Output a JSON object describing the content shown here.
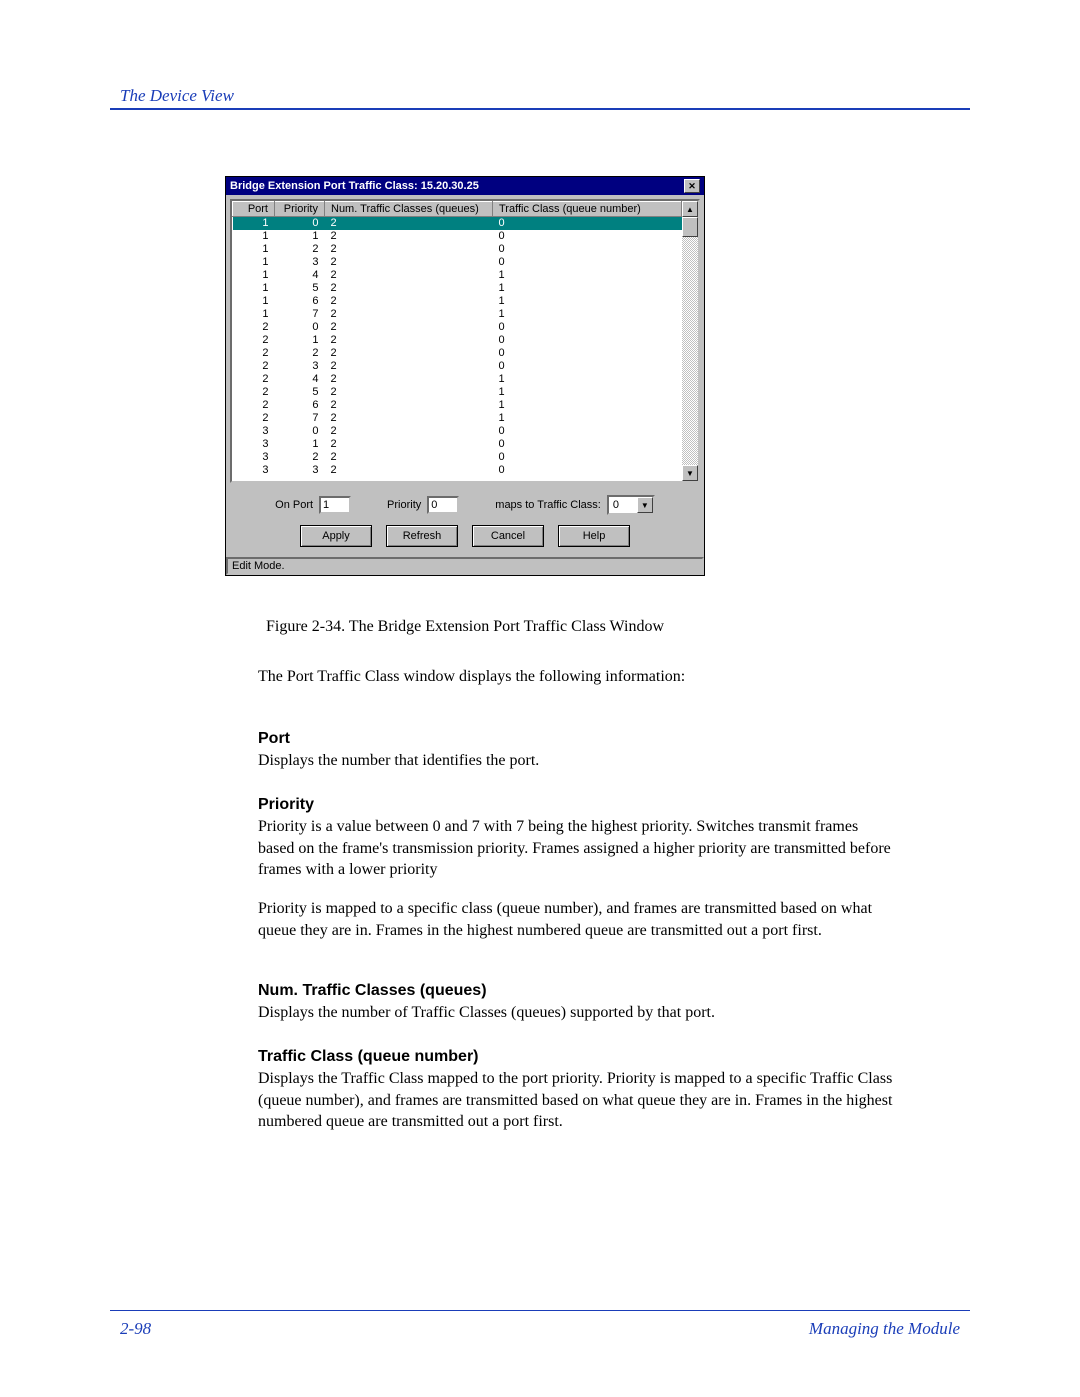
{
  "page": {
    "header": "The Device View",
    "footer_left": "2-98",
    "footer_right": "Managing the Module"
  },
  "figure": {
    "caption_prefix": "Figure 2-34.  ",
    "caption": "The Bridge Extension Port Traffic Class Window"
  },
  "window": {
    "title": "Bridge Extension Port Traffic Class: 15.20.30.25",
    "columns": [
      "Port",
      "Priority",
      "Num. Traffic Classes (queues)",
      "Traffic Class (queue number)"
    ],
    "selected_row": {
      "port": "1",
      "priority": "0",
      "num": "2",
      "tc": "0"
    },
    "rows": [
      {
        "port": "1",
        "priority": "1",
        "num": "2",
        "tc": "0"
      },
      {
        "port": "1",
        "priority": "2",
        "num": "2",
        "tc": "0"
      },
      {
        "port": "1",
        "priority": "3",
        "num": "2",
        "tc": "0"
      },
      {
        "port": "1",
        "priority": "4",
        "num": "2",
        "tc": "1"
      },
      {
        "port": "1",
        "priority": "5",
        "num": "2",
        "tc": "1"
      },
      {
        "port": "1",
        "priority": "6",
        "num": "2",
        "tc": "1"
      },
      {
        "port": "1",
        "priority": "7",
        "num": "2",
        "tc": "1"
      },
      {
        "port": "2",
        "priority": "0",
        "num": "2",
        "tc": "0"
      },
      {
        "port": "2",
        "priority": "1",
        "num": "2",
        "tc": "0"
      },
      {
        "port": "2",
        "priority": "2",
        "num": "2",
        "tc": "0"
      },
      {
        "port": "2",
        "priority": "3",
        "num": "2",
        "tc": "0"
      },
      {
        "port": "2",
        "priority": "4",
        "num": "2",
        "tc": "1"
      },
      {
        "port": "2",
        "priority": "5",
        "num": "2",
        "tc": "1"
      },
      {
        "port": "2",
        "priority": "6",
        "num": "2",
        "tc": "1"
      },
      {
        "port": "2",
        "priority": "7",
        "num": "2",
        "tc": "1"
      },
      {
        "port": "3",
        "priority": "0",
        "num": "2",
        "tc": "0"
      },
      {
        "port": "3",
        "priority": "1",
        "num": "2",
        "tc": "0"
      },
      {
        "port": "3",
        "priority": "2",
        "num": "2",
        "tc": "0"
      },
      {
        "port": "3",
        "priority": "3",
        "num": "2",
        "tc": "0"
      }
    ],
    "form": {
      "on_port_label": "On Port",
      "on_port_value": "1",
      "priority_label": "Priority",
      "priority_value": "0",
      "maps_label": "maps to Traffic Class:",
      "maps_value": "0"
    },
    "buttons": {
      "apply": "Apply",
      "refresh": "Refresh",
      "cancel": "Cancel",
      "help": "Help"
    },
    "statusbar": "Edit Mode."
  },
  "doc": {
    "intro": "The Port Traffic Class window displays the following information:",
    "port_h": "Port",
    "port_p": "Displays the number that identifies the port.",
    "priority_h": "Priority",
    "priority_p": "Priority is a value between 0 and 7 with 7 being the highest priority. Switches transmit frames based on the frame's transmission priority. Frames assigned a higher priority are transmitted before frames with a lower priority",
    "priority_p2": "Priority is mapped to a specific class (queue number), and frames are transmitted based on what queue they are in. Frames in the highest numbered queue are transmitted out a port first.",
    "num_h": "Num. Traffic Classes (queues)",
    "num_p": "Displays the number of Traffic Classes (queues) supported by that port.",
    "tc_h": "Traffic Class (queue number)",
    "tc_p": "Displays the Traffic Class mapped to the port priority. Priority is mapped to a specific Traffic Class (queue number), and frames are transmitted based on what queue they are in. Frames in the highest numbered queue are transmitted out a port first."
  }
}
